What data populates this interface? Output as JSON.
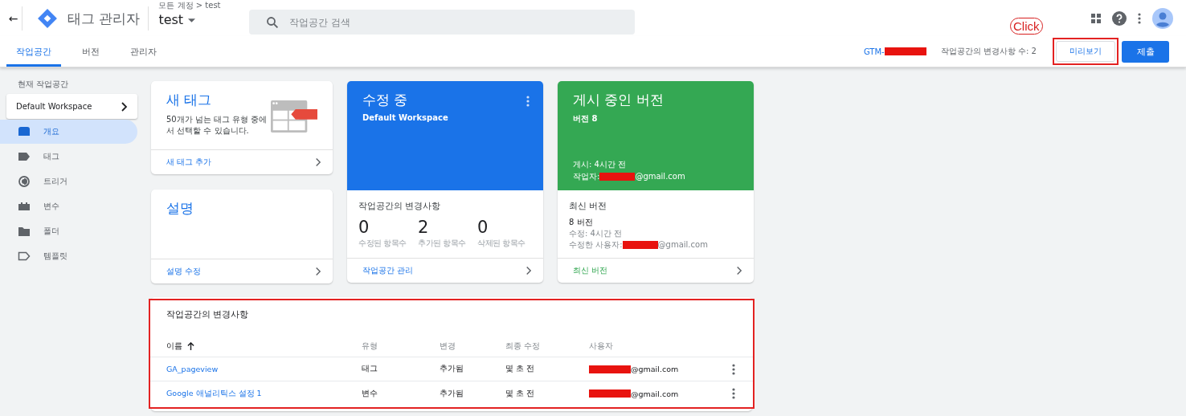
{
  "header": {
    "back": "←",
    "app_title": "태그 관리자",
    "breadcrumb": "모든 계정 > test",
    "container": "test",
    "search": {
      "placeholder": "작업공간 검색"
    }
  },
  "tabs": [
    {
      "label": "작업공간",
      "selected": true
    },
    {
      "label": "버전",
      "selected": false
    },
    {
      "label": "관리자",
      "selected": false
    }
  ],
  "toolbar": {
    "container_id": "GTM-",
    "changes_count": "작업공간의 변경사항 수: 2",
    "preview_button": "미리보기",
    "submit_button": "제출",
    "annotation": "Click"
  },
  "sidebar": {
    "workspace_label": "현재 작업공간",
    "workspace": "Default Workspace",
    "items": [
      {
        "label": "개요",
        "selected": true
      },
      {
        "label": "태그",
        "selected": false
      },
      {
        "label": "트리거",
        "selected": false
      },
      {
        "label": "변수",
        "selected": false
      },
      {
        "label": "폴더",
        "selected": false
      },
      {
        "label": "템플릿",
        "selected": false
      }
    ]
  },
  "new_tag_card": {
    "title": "새 태그",
    "description": "50개가 넘는 태그 유형 중에서 선택할 수 있습니다.",
    "link": "새 태그 추가"
  },
  "description_card": {
    "title": "설명",
    "link": "설명 수정"
  },
  "editing_card": {
    "title": "수정 중",
    "subtitle": "Default Workspace",
    "changes_title": "작업공간의 변경사항",
    "stats": [
      {
        "value": "0",
        "label": "수정된 항목수"
      },
      {
        "value": "2",
        "label": "추가된 항목수"
      },
      {
        "value": "0",
        "label": "삭제된 항목수"
      }
    ],
    "link": "작업공간 관리"
  },
  "live_card": {
    "title": "게시 중인 버전",
    "subtitle": "버전 8",
    "published": "게시: 4시간 전",
    "author_label": "작업자:",
    "author_email": "@gmail.com",
    "latest_title": "최신 버전",
    "latest_version": "8 버전",
    "modified": "수정: 4시간 전",
    "modified_by_label": "수정한 사용자:",
    "modified_by_email": "@gmail.com",
    "link": "최신 버전"
  },
  "changes_table": {
    "title": "작업공간의 변경사항",
    "columns": [
      "이름",
      "유형",
      "변경",
      "최종 수정",
      "사용자"
    ],
    "rows": [
      {
        "name": "GA_pageview",
        "type": "태그",
        "change": "추가됨",
        "modified": "몇 초 전",
        "user": "@gmail.com"
      },
      {
        "name": "Google 애널리틱스 설정 1",
        "type": "변수",
        "change": "추가됨",
        "modified": "몇 초 전",
        "user": "@gmail.com"
      }
    ]
  }
}
